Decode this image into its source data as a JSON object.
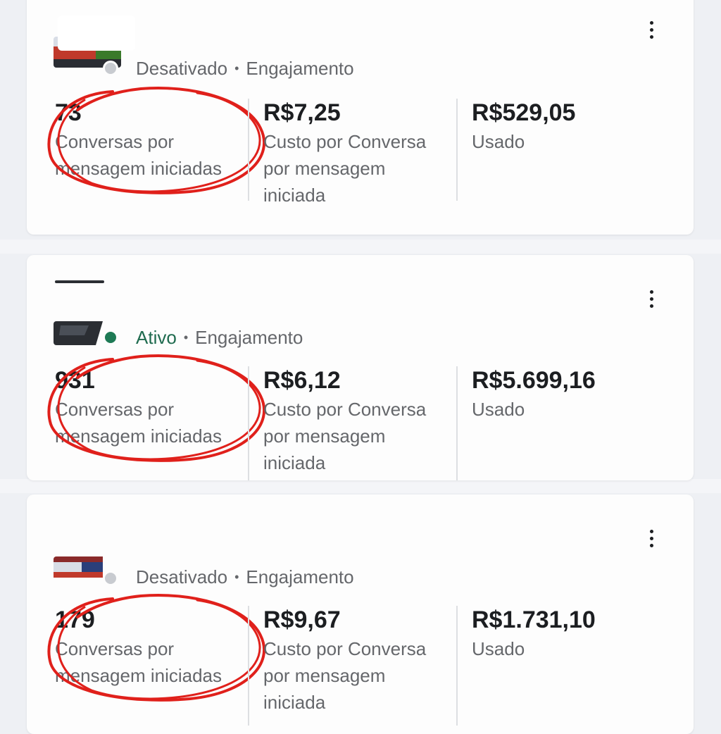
{
  "campaigns": [
    {
      "status": "Desativado",
      "status_color": "#65676b",
      "dot_color": "#c8cbd0",
      "objective": "Engajamento",
      "separator": "•",
      "menu_icon": "more-vertical-icon",
      "metrics": [
        {
          "value": "73",
          "label_lines": [
            "Conversas por",
            "mensagem iniciadas"
          ]
        },
        {
          "value": "R$7,25",
          "label_lines": [
            "Custo por Conversa",
            "por mensagem",
            "iniciada"
          ]
        },
        {
          "value": "R$529,05",
          "label_lines": [
            "Usado"
          ]
        }
      ]
    },
    {
      "status": "Ativo",
      "status_color": "#1f6b4f",
      "dot_color": "#1e7a55",
      "objective": "Engajamento",
      "separator": "•",
      "menu_icon": "more-vertical-icon",
      "metrics": [
        {
          "value": "931",
          "label_lines": [
            "Conversas por",
            "mensagem iniciadas"
          ]
        },
        {
          "value": "R$6,12",
          "label_lines": [
            "Custo por Conversa",
            "por mensagem",
            "iniciada"
          ]
        },
        {
          "value": "R$5.699,16",
          "label_lines": [
            "Usado"
          ]
        }
      ]
    },
    {
      "status": "Desativado",
      "status_color": "#65676b",
      "dot_color": "#c8cbd0",
      "objective": "Engajamento",
      "separator": "•",
      "menu_icon": "more-vertical-icon",
      "metrics": [
        {
          "value": "179",
          "label_lines": [
            "Conversas por",
            "mensagem iniciadas"
          ]
        },
        {
          "value": "R$9,67",
          "label_lines": [
            "Custo por Conversa",
            "por mensagem",
            "iniciada"
          ]
        },
        {
          "value": "R$1.731,10",
          "label_lines": [
            "Usado"
          ]
        }
      ]
    }
  ],
  "annotation_color": "#e0201b"
}
